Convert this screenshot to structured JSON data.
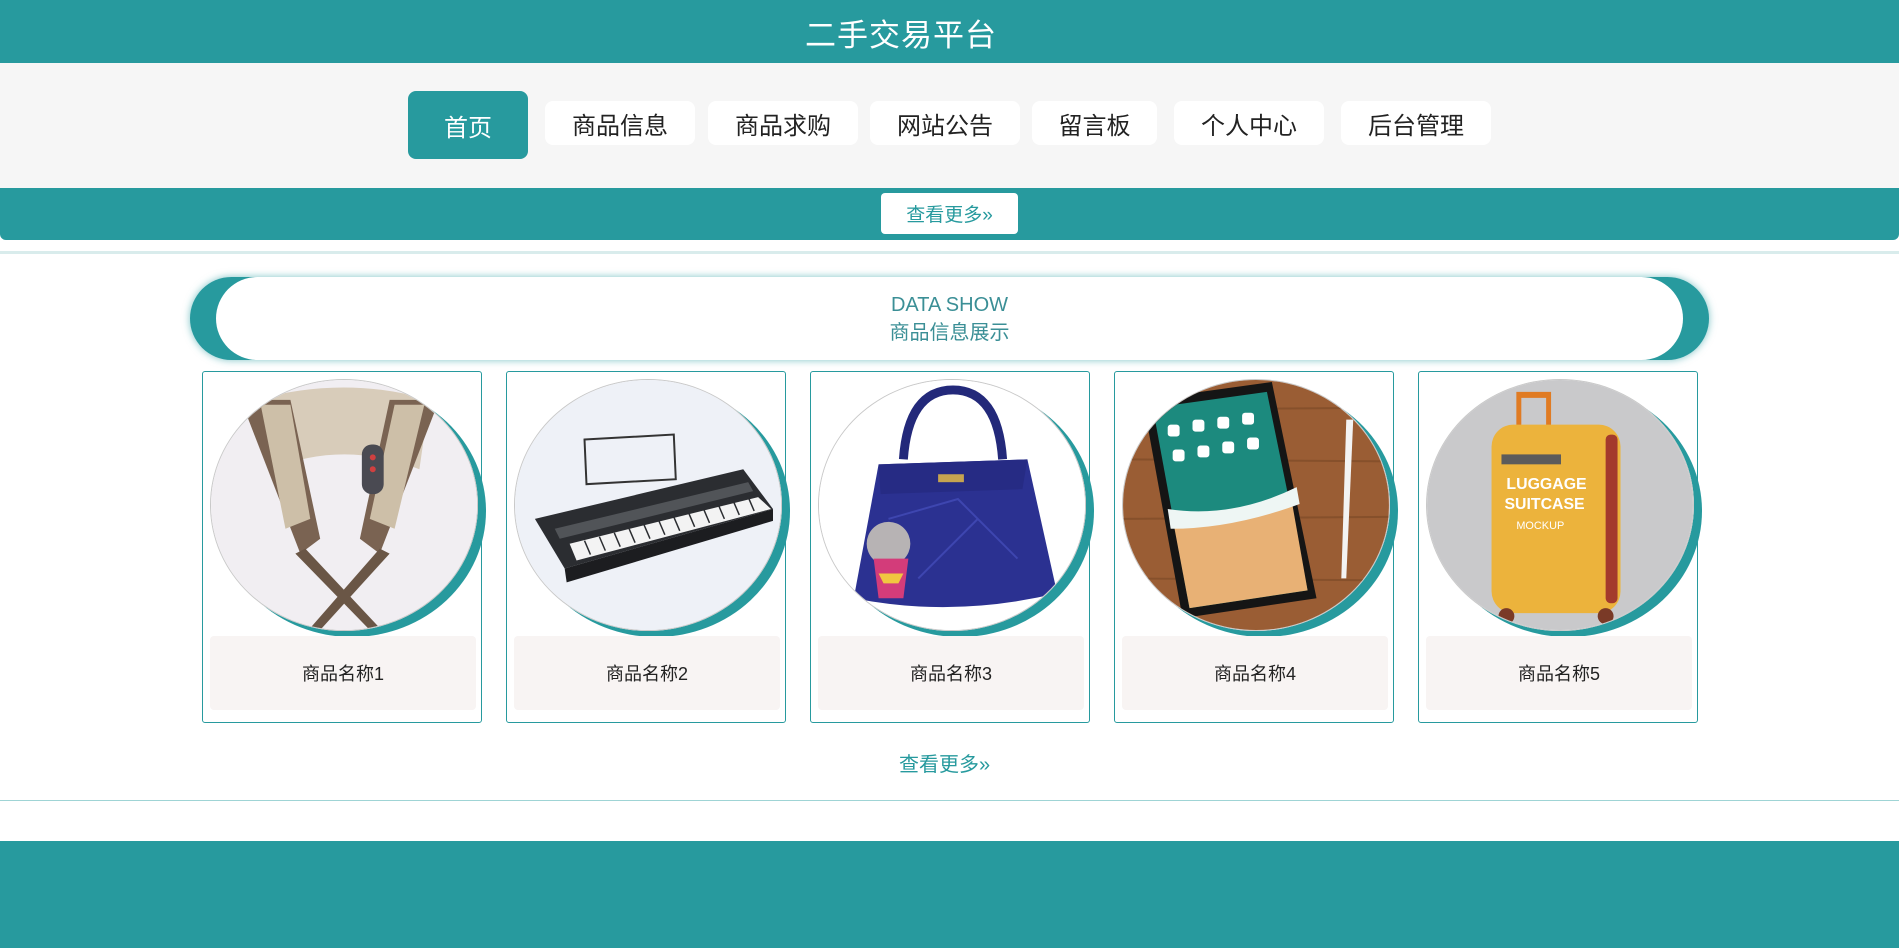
{
  "header": {
    "title": "二手交易平台"
  },
  "nav": {
    "items": [
      {
        "label": "首页",
        "active": true
      },
      {
        "label": "商品信息"
      },
      {
        "label": "商品求购"
      },
      {
        "label": "网站公告"
      },
      {
        "label": "留言板"
      },
      {
        "label": "个人中心"
      },
      {
        "label": "后台管理"
      }
    ]
  },
  "banner": {
    "more_label": "查看更多»"
  },
  "section": {
    "title_en": "DATA SHOW",
    "title_cn": "商品信息展示"
  },
  "products": [
    {
      "name": "商品名称1",
      "image": "neck-massager"
    },
    {
      "name": "商品名称2",
      "image": "electronic-keyboard"
    },
    {
      "name": "商品名称3",
      "image": "handbag"
    },
    {
      "name": "商品名称4",
      "image": "tablet"
    },
    {
      "name": "商品名称5",
      "image": "suitcase"
    }
  ],
  "suitcase_print": {
    "line1": "LUGGAGE",
    "line2": "SUITCASE",
    "line3": "MOCKUP"
  },
  "more_label": "查看更多»",
  "colors": {
    "primary": "#279a9e",
    "nav_bg": "#f6f6f6",
    "card_name_bg": "#f8f4f3"
  }
}
